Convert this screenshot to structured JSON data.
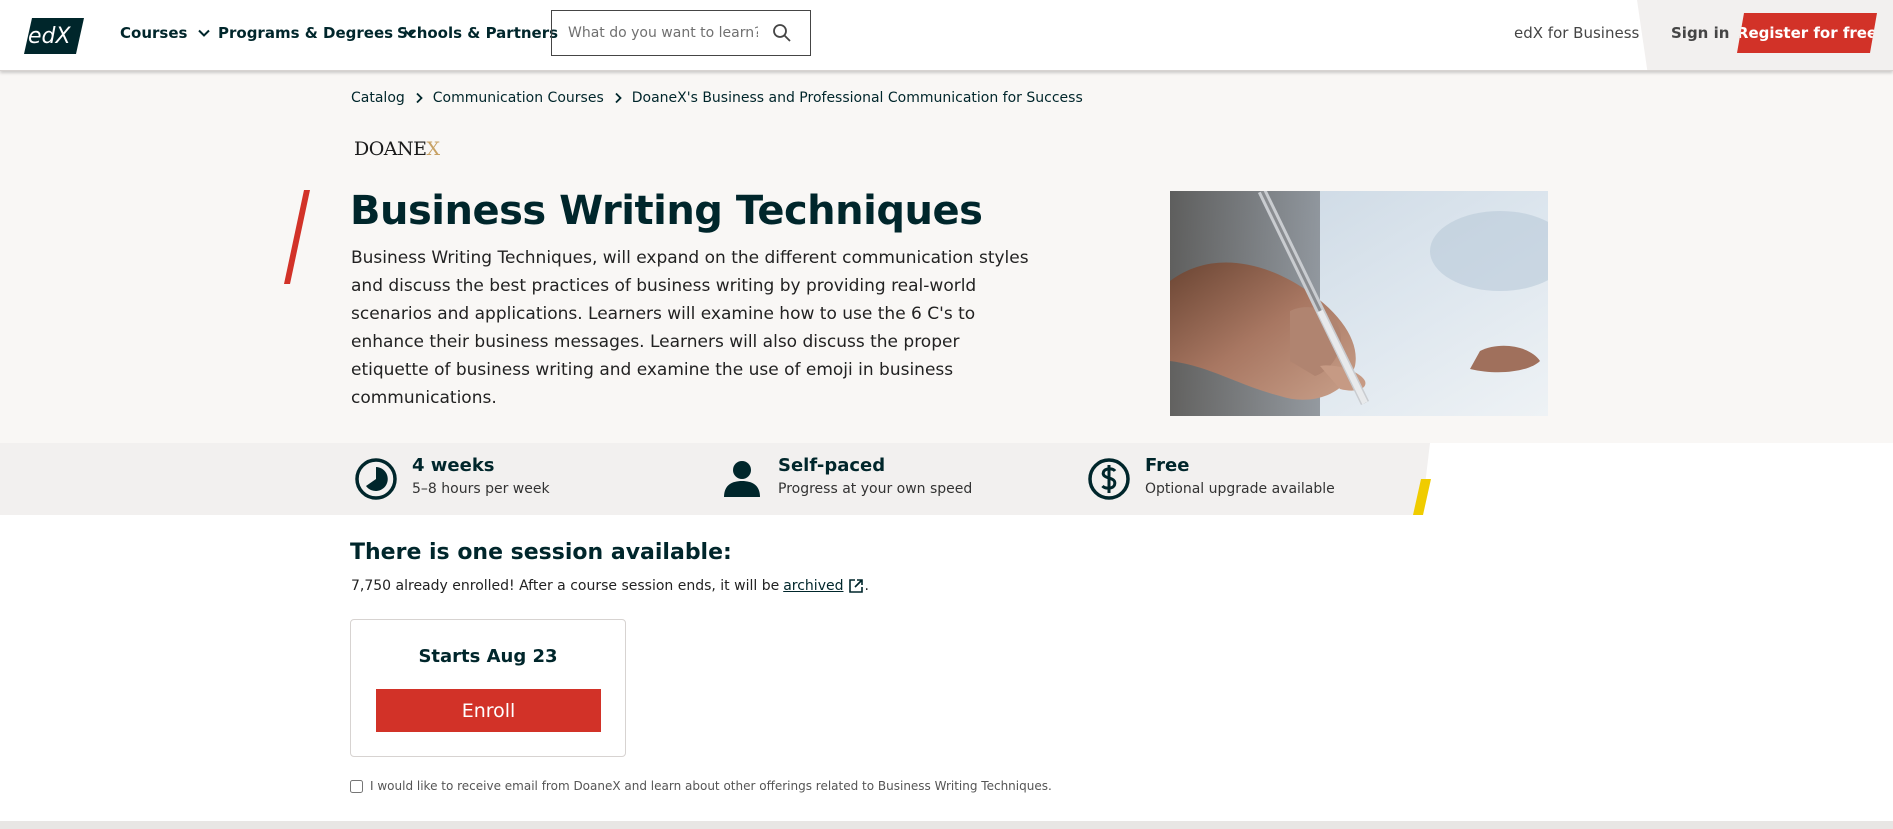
{
  "nav": {
    "logo_text": "edX",
    "courses_label": "Courses",
    "programs_label": "Programs & Degrees",
    "schools_label": "Schools & Partners",
    "search_placeholder": "What do you want to learn?",
    "business_label": "edX for Business",
    "signin_label": "Sign in",
    "register_label": "Register for free"
  },
  "breadcrumb": {
    "items": [
      "Catalog",
      "Communication Courses",
      "DoaneX's Business and Professional Communication for Success"
    ]
  },
  "org": {
    "logo_main": "DOANE",
    "logo_x": "X"
  },
  "course": {
    "title": "Business Writing Techniques",
    "description": "Business Writing Techniques, will expand on the different communication styles and discuss the best practices of business writing by providing real-world scenarios and applications. Learners will examine how to use the 6 C's to enhance their business messages. Learners will also discuss the proper etiquette of business writing and examine the use of emoji in business communications."
  },
  "stats": [
    {
      "icon": "clock-icon",
      "title": "4 weeks",
      "sub": "5–8 hours per week"
    },
    {
      "icon": "person-icon",
      "title": "Self-paced",
      "sub": "Progress at your own speed"
    },
    {
      "icon": "dollar-icon",
      "title": "Free",
      "sub": "Optional upgrade available"
    }
  ],
  "session": {
    "heading": "There is one session available:",
    "enrolled_text": "7,750 already enrolled! After a course session ends, it will be",
    "archived_link": "archived",
    "trailing": ".",
    "start_label": "Starts Aug 23",
    "enroll_label": "Enroll"
  },
  "optin": {
    "label": "I would like to receive email from DoaneX and learn about other offerings related to Business Writing Techniques."
  },
  "colors": {
    "brand_red": "#d23228",
    "ink": "#00262b",
    "accent_yellow": "#f0cc00",
    "hero_bg": "#f9f7f5"
  }
}
